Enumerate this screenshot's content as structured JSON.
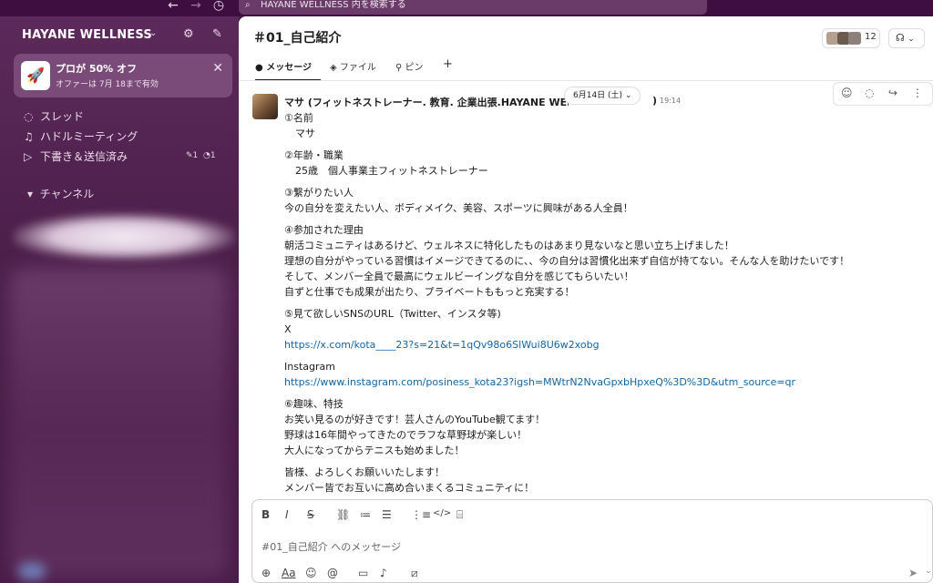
{
  "topbar": {
    "search_placeholder": "HAYANE WELLNESS 内を検索する",
    "back_icon": "arrow-left-icon",
    "forward_icon": "arrow-right-icon",
    "history_icon": "clock-icon"
  },
  "sidebar": {
    "workspace_name": "HAYANE WELLNESS",
    "promo": {
      "title": "プロが 50% オフ",
      "subtitle": "オファーは 7月 18まで有効"
    },
    "items": [
      {
        "label": "スレッド",
        "icon": "threads-icon"
      },
      {
        "label": "ハドルミーティング",
        "icon": "headphones-icon"
      },
      {
        "label": "下書き＆送信済み",
        "icon": "send-icon"
      }
    ],
    "drafts_badge_edit": "1",
    "drafts_badge_sent": "1",
    "channels_header": "チャンネル"
  },
  "channel": {
    "title": "＃01_自己紹介",
    "member_count": "12",
    "tabs": [
      "メッセージ",
      "ファイル",
      "ピン"
    ]
  },
  "message": {
    "date_pill": "6月14日 (土)",
    "sender": "マサ (フィットネストレーナー. 教育. 企業出張.HAYANE WELLNESS",
    "sender_tail": ")",
    "timestamp": "19:14",
    "lines": {
      "l1": "①名前",
      "l2": "マサ",
      "l3": "②年齢・職業",
      "l4": "25歳　個人事業主フィットネストレーナー",
      "l5": "③繋がりたい人",
      "l6": "今の自分を変えたい人、ボディメイク、美容、スポーツに興味がある人全員！",
      "l7": "④参加された理由",
      "l8": "朝活コミュニティはあるけど、ウェルネスに特化したものはあまり見ないなと思い立ち上げました！",
      "l9": "理想の自分がやっている習慣はイメージできてるのに、、今の自分は習慣化出来ず自信が持てない。そんな人を助けたいです！",
      "l10": "そして、メンバー全員で最高にウェルビーイングな自分を感じてもらいたい！",
      "l11": "自ずと仕事でも成果が出たり、プライベートももっと充実する！",
      "l12": "⑤見て欲しいSNSのURL（Twitter、インスタ等)",
      "l13": "X",
      "l14": "https://x.com/kota____23?s=21&t=1qQv98o6SlWui8U6w2xobg",
      "l15": "Instagram",
      "l16": "https://www.instagram.com/posiness_kota23?igsh=MWtrN2NvaGpxbHpxeQ%3D%3D&utm_source=qr",
      "l17": "⑥趣味、特技",
      "l18": "お笑い見るのが好きです！芸人さんのYouTube観てます！",
      "l19": "野球は16年間やってきたのでラフな草野球が楽しい！",
      "l20": "大人になってからテニスも始めました！",
      "l21": "皆様、よろしくお願いいたします！",
      "l22": "メンバー皆でお互いに高め合いまくるコミュニティに！"
    }
  },
  "composer": {
    "placeholder": "#01_自己紹介 へのメッセージ"
  }
}
